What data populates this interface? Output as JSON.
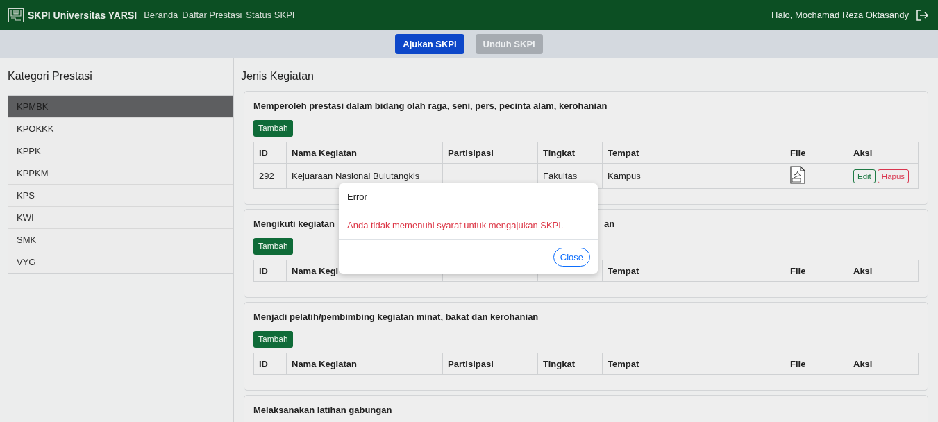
{
  "navbar": {
    "brand": "SKPI Universitas YARSI",
    "links": [
      "Beranda",
      "Daftar Prestasi",
      "Status SKPI"
    ],
    "greeting": "Halo, Mochamad Reza Oktasandy"
  },
  "toolbar": {
    "buttons": [
      {
        "label": "Ajukan SKPI",
        "disabled": false
      },
      {
        "label": "Unduh SKPI",
        "disabled": true
      }
    ]
  },
  "sidebar": {
    "title": "Kategori Prestasi",
    "items": [
      {
        "label": "KPMBK",
        "selected": true
      },
      {
        "label": "KPOKKK",
        "selected": false
      },
      {
        "label": "KPPK",
        "selected": false
      },
      {
        "label": "KPPKM",
        "selected": false
      },
      {
        "label": "KPS",
        "selected": false
      },
      {
        "label": "KWI",
        "selected": false
      },
      {
        "label": "SMK",
        "selected": false
      },
      {
        "label": "VYG",
        "selected": false
      }
    ]
  },
  "main": {
    "title": "Jenis Kegiatan",
    "sections": [
      {
        "title": [
          "Memperoleh prestasi dalam bidang olah raga, seni, pers, pecinta alam, kerohanian"
        ],
        "add_button": "Tambah",
        "columns": [
          {
            "label": "ID"
          },
          {
            "label": "Nama Kegiatan"
          },
          {
            "label": "Partisipasi"
          },
          {
            "label": "Tingkat"
          },
          {
            "label": "Tempat"
          },
          {
            "label": "File"
          },
          {
            "label": "Aksi"
          }
        ],
        "rows": [
          {
            "cells": [
              "292",
              "Kejuaraan Nasional Bulutangkis",
              "",
              "Fakultas",
              "Kampus"
            ],
            "has_file": true,
            "actions": [
              "Edit",
              "Hapus"
            ]
          }
        ]
      },
      {
        "title": [
          "Mengikuti kegiatan",
          "an"
        ],
        "add_button": "Tambah",
        "columns": [
          {
            "label": "ID"
          },
          {
            "label": "Nama Kegi"
          },
          {},
          {},
          {
            "label": "Tempat"
          },
          {
            "label": "File"
          },
          {
            "label": "Aksi"
          }
        ]
      },
      {
        "title": [
          "Menjadi pelatih/pembimbing kegiatan minat, bakat dan kerohanian"
        ],
        "add_button": "Tambah",
        "columns": [
          {
            "label": "ID"
          },
          {
            "label": "Nama Kegiatan"
          },
          {
            "label": "Partisipasi"
          },
          {
            "label": "Tingkat"
          },
          {
            "label": "Tempat"
          },
          {
            "label": "File"
          },
          {
            "label": "Aksi"
          }
        ]
      },
      {
        "title": [
          "Melaksanakan latihan gabungan"
        ]
      }
    ]
  },
  "modal": {
    "title": "Error",
    "message": "Anda tidak memenuhi syarat untuk mengajukan SKPI.",
    "button": "Close"
  }
}
